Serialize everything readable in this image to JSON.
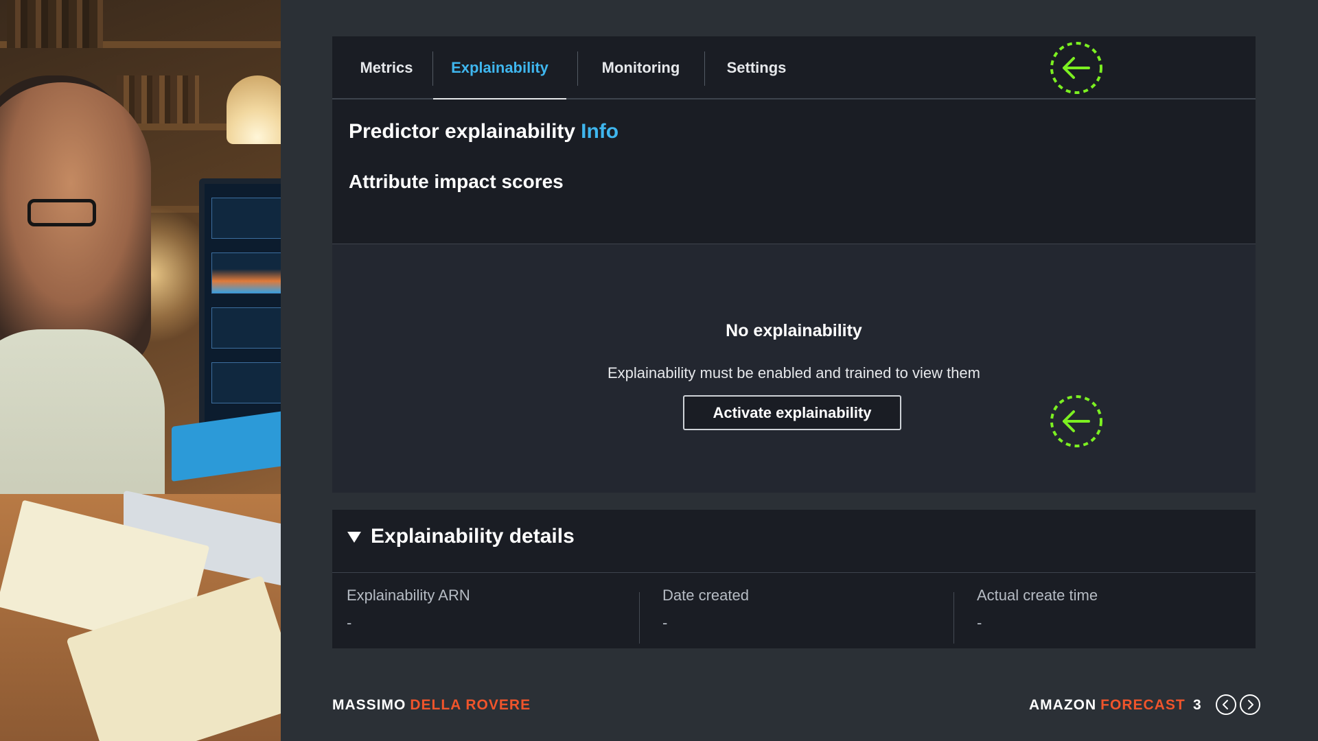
{
  "tabs": [
    {
      "label": "Metrics",
      "active": false
    },
    {
      "label": "Explainability",
      "active": true
    },
    {
      "label": "Monitoring",
      "active": false
    },
    {
      "label": "Settings",
      "active": false
    }
  ],
  "explainability": {
    "title": "Predictor explainability",
    "info_link": "Info",
    "subtitle": "Attribute impact scores",
    "empty_title": "No explainability",
    "empty_description": "Explainability must be enabled and trained to view them",
    "activate_button": "Activate explainability"
  },
  "details": {
    "title": "Explainability details",
    "fields": [
      {
        "label": "Explainability ARN",
        "value": "-"
      },
      {
        "label": "Date created",
        "value": "-"
      },
      {
        "label": "Actual create time",
        "value": "-"
      }
    ]
  },
  "footer": {
    "author_first": "MASSIMO",
    "author_last": "DELLA ROVERE",
    "course_first": "AMAZON",
    "course_last": "FORECAST",
    "page_number": "3"
  },
  "colors": {
    "accent_blue": "#3fb6ee",
    "accent_orange": "#f0542b",
    "callout_green": "#7cf021",
    "background": "#2b3036",
    "panel": "#1a1d24"
  },
  "icons": {
    "callout": "arrow-left-icon",
    "prev": "chevron-left-icon",
    "next": "chevron-right-icon",
    "expand": "caret-down-icon"
  }
}
